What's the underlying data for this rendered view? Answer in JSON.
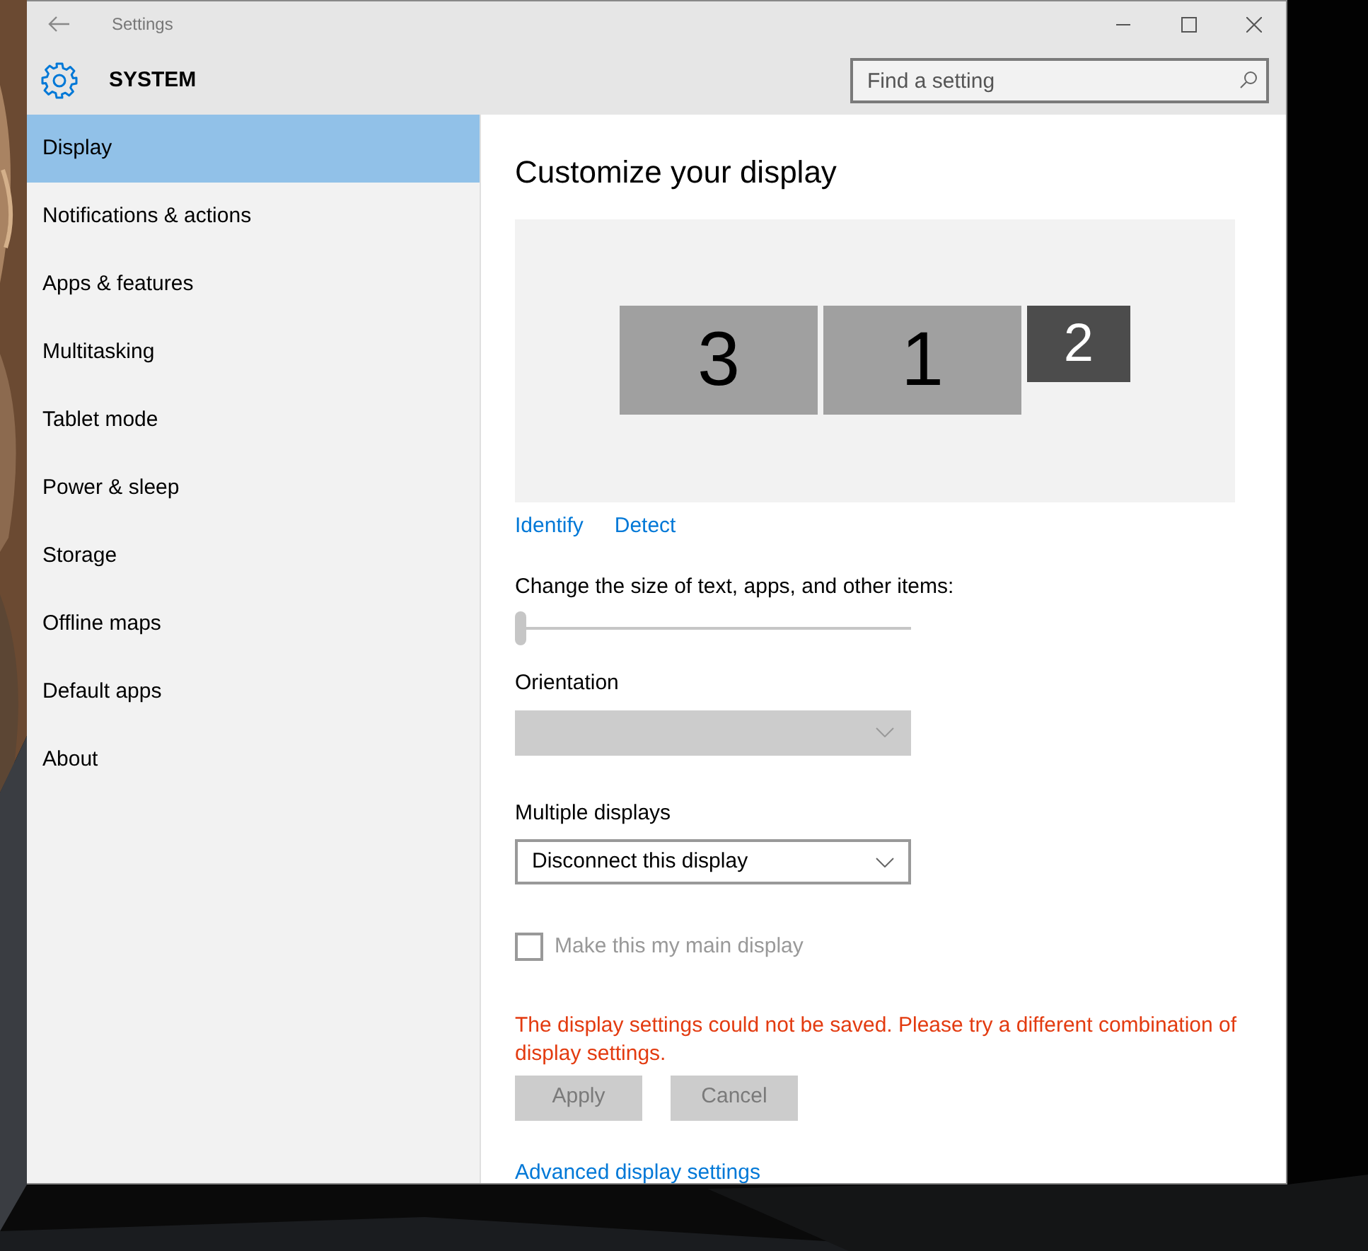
{
  "window": {
    "title": "Settings"
  },
  "header": {
    "title": "SYSTEM",
    "search": {
      "placeholder": "Find a setting"
    }
  },
  "sidebar": {
    "items": [
      {
        "label": "Display",
        "selected": true
      },
      {
        "label": "Notifications & actions",
        "selected": false
      },
      {
        "label": "Apps & features",
        "selected": false
      },
      {
        "label": "Multitasking",
        "selected": false
      },
      {
        "label": "Tablet mode",
        "selected": false
      },
      {
        "label": "Power & sleep",
        "selected": false
      },
      {
        "label": "Storage",
        "selected": false
      },
      {
        "label": "Offline maps",
        "selected": false
      },
      {
        "label": "Default apps",
        "selected": false
      },
      {
        "label": "About",
        "selected": false
      }
    ]
  },
  "content": {
    "heading": "Customize your display",
    "monitors": [
      {
        "label": "3",
        "selected": false
      },
      {
        "label": "1",
        "selected": false
      },
      {
        "label": "2",
        "selected": true
      }
    ],
    "links": [
      "Identify",
      "Detect"
    ],
    "scale": {
      "label": "Change the size of text, apps, and other items:",
      "level": 0,
      "disabled": true
    },
    "orientation": {
      "label": "Orientation",
      "disabled": true
    },
    "multiple_displays": {
      "label": "Multiple displays",
      "value": "Disconnect this display",
      "disabled": false
    },
    "main_display": {
      "label": "Make this my main display",
      "checked": false,
      "disabled": true
    },
    "error": "The display settings could not be saved. Please try a different combination of display settings.",
    "buttons": [
      {
        "label": "Apply",
        "disabled": true
      },
      {
        "label": "Cancel",
        "disabled": true
      }
    ],
    "advanced_link": "Advanced display settings"
  }
}
